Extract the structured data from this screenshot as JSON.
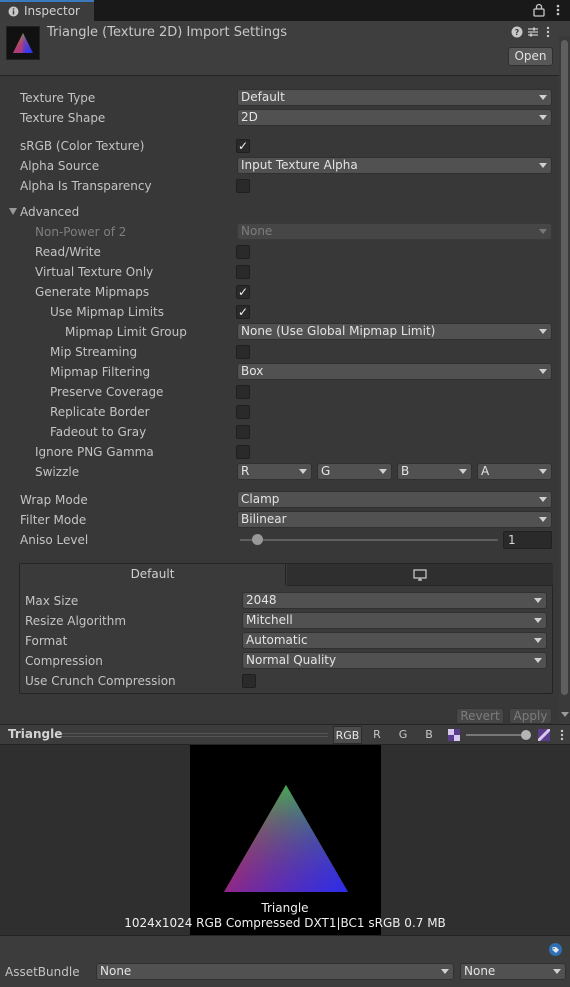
{
  "window": {
    "tab_label": "Inspector"
  },
  "header": {
    "title": "Triangle (Texture 2D) Import Settings",
    "open_label": "Open"
  },
  "properties": {
    "texture_type": {
      "label": "Texture Type",
      "value": "Default"
    },
    "texture_shape": {
      "label": "Texture Shape",
      "value": "2D"
    },
    "srgb": {
      "label": "sRGB (Color Texture)",
      "checked": true
    },
    "alpha_source": {
      "label": "Alpha Source",
      "value": "Input Texture Alpha"
    },
    "alpha_is_transparency": {
      "label": "Alpha Is Transparency",
      "checked": false
    }
  },
  "advanced": {
    "label": "Advanced",
    "non_power_of_2": {
      "label": "Non-Power of 2",
      "value": "None",
      "disabled": true
    },
    "read_write": {
      "label": "Read/Write",
      "checked": false
    },
    "virtual_texture_only": {
      "label": "Virtual Texture Only",
      "checked": false
    },
    "generate_mipmaps": {
      "label": "Generate Mipmaps",
      "checked": true
    },
    "use_mipmap_limits": {
      "label": "Use Mipmap Limits",
      "checked": true
    },
    "mipmap_limit_group": {
      "label": "Mipmap Limit Group",
      "value": "None (Use Global Mipmap Limit)"
    },
    "mip_streaming": {
      "label": "Mip Streaming",
      "checked": false
    },
    "mipmap_filtering": {
      "label": "Mipmap Filtering",
      "value": "Box"
    },
    "preserve_coverage": {
      "label": "Preserve Coverage",
      "checked": false
    },
    "replicate_border": {
      "label": "Replicate Border",
      "checked": false
    },
    "fadeout_to_gray": {
      "label": "Fadeout to Gray",
      "checked": false
    },
    "ignore_png_gamma": {
      "label": "Ignore PNG Gamma",
      "checked": false
    },
    "swizzle": {
      "label": "Swizzle",
      "r": "R",
      "g": "G",
      "b": "B",
      "a": "A"
    }
  },
  "sampling": {
    "wrap_mode": {
      "label": "Wrap Mode",
      "value": "Clamp"
    },
    "filter_mode": {
      "label": "Filter Mode",
      "value": "Bilinear"
    },
    "aniso_level": {
      "label": "Aniso Level",
      "value": "1",
      "slider_fraction": 0.06
    }
  },
  "platform": {
    "tab_default": "Default",
    "tab_standalone_icon": "monitor-icon",
    "max_size": {
      "label": "Max Size",
      "value": "2048"
    },
    "resize_algorithm": {
      "label": "Resize Algorithm",
      "value": "Mitchell"
    },
    "format": {
      "label": "Format",
      "value": "Automatic"
    },
    "compression": {
      "label": "Compression",
      "value": "Normal Quality"
    },
    "use_crunch": {
      "label": "Use Crunch Compression",
      "checked": false
    }
  },
  "actions": {
    "revert": "Revert",
    "apply": "Apply"
  },
  "preview": {
    "title": "Triangle",
    "channels": [
      "RGB",
      "R",
      "G",
      "B"
    ],
    "mip_fraction": 0.9,
    "name": "Triangle",
    "info": "1024x1024  RGB Compressed DXT1|BC1 sRGB   0.7 MB"
  },
  "footer": {
    "assetbundle_label": "AssetBundle",
    "bundle_value": "None",
    "variant_value": "None"
  },
  "colors": {
    "accent": "#3a79bb",
    "background": "#383838",
    "field": "#515151"
  }
}
